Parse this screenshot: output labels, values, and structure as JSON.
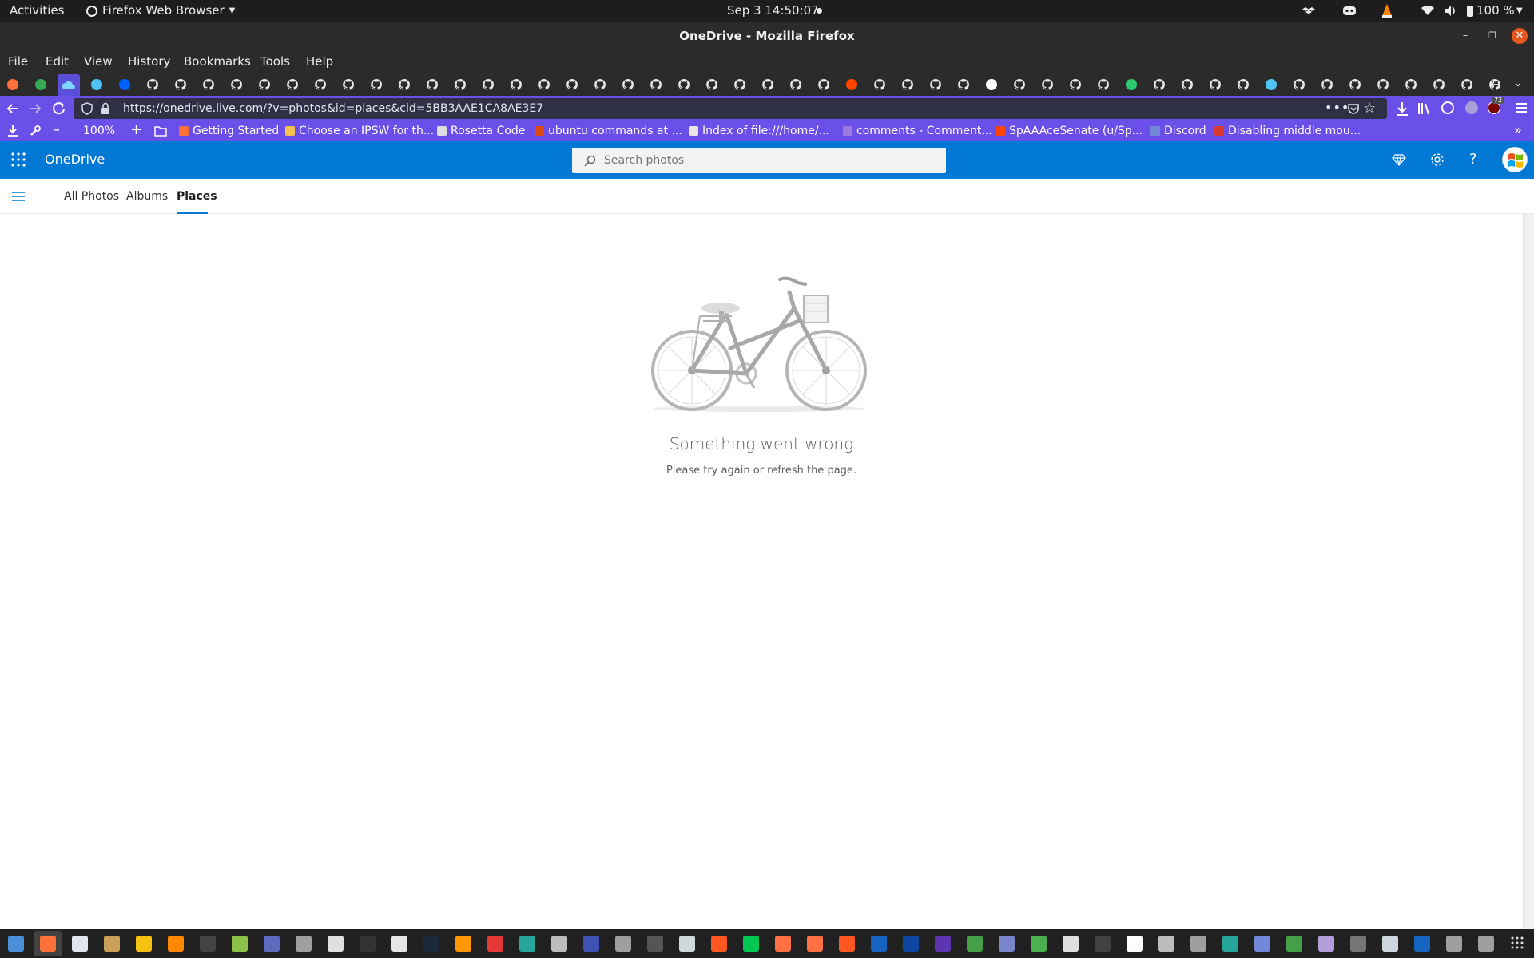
{
  "system_bar": {
    "activities": "Activities",
    "app_name": "Firefox Web Browser",
    "datetime": "Sep 3  14:50:07",
    "battery": "100 %"
  },
  "window": {
    "title": "OneDrive - Mozilla Firefox"
  },
  "menu": {
    "file": "File",
    "edit": "Edit",
    "view": "View",
    "history": "History",
    "bookmarks": "Bookmarks",
    "tools": "Tools",
    "help": "Help"
  },
  "navigation": {
    "url": "https://onedrive.live.com/?v=photos&id=places&cid=5BB3AAE1CA8AE3E7",
    "zoom": "100%",
    "extension_badge": "72"
  },
  "bookmarks": [
    {
      "label": "Getting Started",
      "color": "#ff7139"
    },
    {
      "label": "Choose an IPSW for th...",
      "color": "#f2c14e"
    },
    {
      "label": "Rosetta Code",
      "color": "#dddddd"
    },
    {
      "label": "ubuntu commands at ...",
      "color": "#de4815"
    },
    {
      "label": "Index of file:///home/...",
      "color": "#e8e8e8"
    },
    {
      "label": "comments - Comment...",
      "color": "#9b7be0"
    },
    {
      "label": "SpAAAceSenate (u/Sp...",
      "color": "#ff4500"
    },
    {
      "label": "Discord",
      "color": "#7289da"
    },
    {
      "label": "Disabling middle mou...",
      "color": "#d93a2b"
    }
  ],
  "onedrive": {
    "brand": "OneDrive",
    "search_placeholder": "Search photos",
    "tabs": [
      "All Photos",
      "Albums",
      "Places"
    ],
    "active_tab": "Places",
    "error_title": "Something went wrong",
    "error_message": "Please try again or refresh the page."
  },
  "colors": {
    "onedrive_blue": "#0078d4",
    "firefox_purple": "#6a50e8",
    "topbar": "#1d1d1d",
    "titlebar": "#2b2b2b"
  }
}
